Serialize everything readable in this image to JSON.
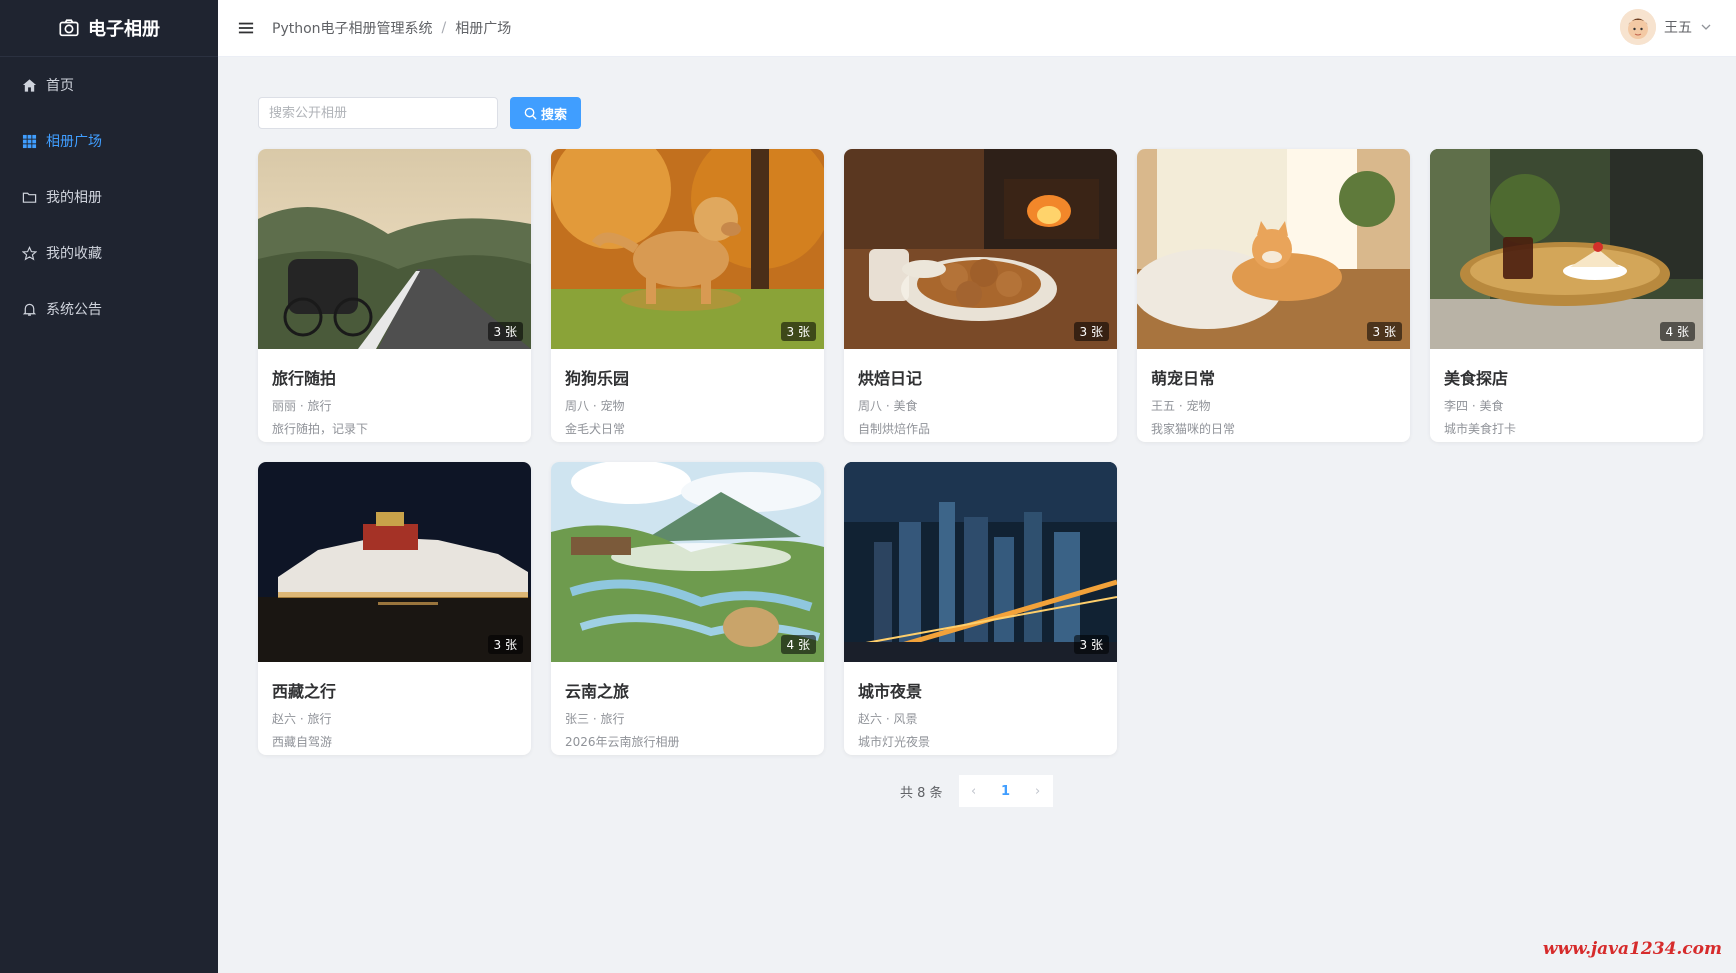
{
  "app": {
    "title": "电子相册"
  },
  "sidebar": {
    "items": [
      {
        "label": "首页",
        "icon": "home-icon",
        "active": false
      },
      {
        "label": "相册广场",
        "icon": "grid-icon",
        "active": true
      },
      {
        "label": "我的相册",
        "icon": "folder-icon",
        "active": false
      },
      {
        "label": "我的收藏",
        "icon": "star-icon",
        "active": false
      },
      {
        "label": "系统公告",
        "icon": "bell-icon",
        "active": false
      }
    ]
  },
  "header": {
    "breadcrumb": [
      "Python电子相册管理系统",
      "相册广场"
    ],
    "separator": "/",
    "user_name": "王五"
  },
  "search": {
    "placeholder": "搜索公开相册",
    "value": "",
    "button_label": "搜索"
  },
  "albums": [
    {
      "title": "旅行随拍",
      "meta": "丽丽 · 旅行",
      "desc": "旅行随拍，记录下",
      "count": "3 张"
    },
    {
      "title": "狗狗乐园",
      "meta": "周八 · 宠物",
      "desc": "金毛犬日常",
      "count": "3 张"
    },
    {
      "title": "烘焙日记",
      "meta": "周八 · 美食",
      "desc": "自制烘焙作品",
      "count": "3 张"
    },
    {
      "title": "萌宠日常",
      "meta": "王五 · 宠物",
      "desc": "我家猫咪的日常",
      "count": "3 张"
    },
    {
      "title": "美食探店",
      "meta": "李四 · 美食",
      "desc": "城市美食打卡",
      "count": "4 张"
    },
    {
      "title": "西藏之行",
      "meta": "赵六 · 旅行",
      "desc": "西藏自驾游",
      "count": "3 张"
    },
    {
      "title": "云南之旅",
      "meta": "张三 · 旅行",
      "desc": "2026年云南旅行相册",
      "count": "4 张"
    },
    {
      "title": "城市夜景",
      "meta": "赵六 · 风景",
      "desc": "城市灯光夜景",
      "count": "3 张"
    }
  ],
  "pagination": {
    "total_text": "共 8 条",
    "current_page": "1",
    "prev": "‹",
    "next": "›"
  },
  "watermark": "www.java1234.com",
  "colors": {
    "sidebar_bg": "#1f2430",
    "accent": "#409eff",
    "page_bg": "#f0f2f5",
    "watermark": "#d62b2b"
  }
}
